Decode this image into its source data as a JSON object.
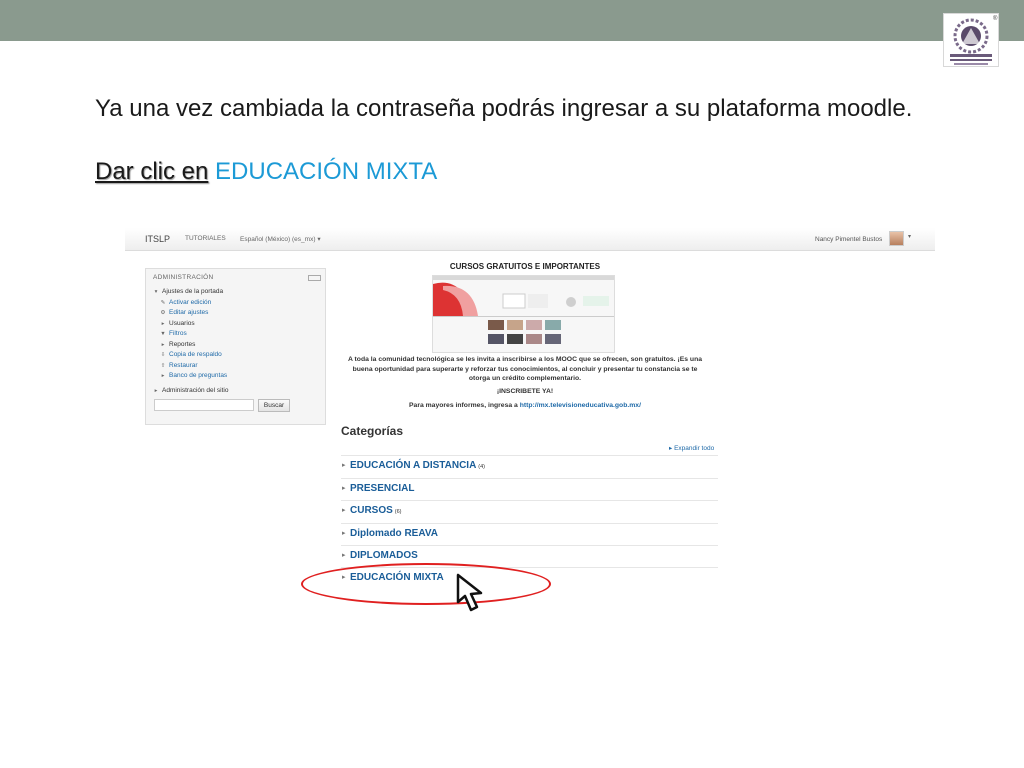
{
  "slide": {
    "instruction": "Ya una vez cambiada la contraseña podrás ingresar a su plataforma moodle.",
    "cta_prefix": "Dar clic en",
    "cta_highlight": "EDUCACIÓN MIXTA",
    "logo": "institution-seal-icon",
    "logo_mark": "®"
  },
  "moodle": {
    "nav": {
      "brand": "ITSLP",
      "tutoriales": "TUTORIALES",
      "language": "Español (México) (es_mx)",
      "language_caret": "▾",
      "user_name": "Nancy Pimentel Bustos",
      "user_caret": "▾"
    },
    "admin": {
      "title": "ADMINISTRACIÓN",
      "section": "Ajustes de la portada",
      "items": [
        {
          "label": "Activar edición",
          "icon": "pencil-icon",
          "glyph": "✎",
          "link": true
        },
        {
          "label": "Editar ajustes",
          "icon": "gear-icon",
          "glyph": "⚙",
          "link": true
        },
        {
          "label": "Usuarios",
          "icon": "chevron-right-icon",
          "glyph": "▸",
          "link": false
        },
        {
          "label": "Filtros",
          "icon": "filter-icon",
          "glyph": "▼",
          "link": true
        },
        {
          "label": "Reportes",
          "icon": "chevron-right-icon",
          "glyph": "▸",
          "link": false
        },
        {
          "label": "Copia de respaldo",
          "icon": "backup-icon",
          "glyph": "⇩",
          "link": true
        },
        {
          "label": "Restaurar",
          "icon": "restore-icon",
          "glyph": "⇧",
          "link": true
        },
        {
          "label": "Banco de preguntas",
          "icon": "chevron-right-icon",
          "glyph": "▸",
          "link": true
        }
      ],
      "site_admin": "Administración del sitio",
      "search_button": "Buscar"
    },
    "promo": {
      "title": "CURSOS GRATUITOS E IMPORTANTES",
      "body": "A toda la comunidad tecnológica se les invita a inscribirse a los MOOC que se ofrecen, son gratuitos. ¡Es una buena oportunidad para superarte y reforzar tus conocimientos, al concluir y presentar tu constancia se te otorga un crédito complementario.",
      "cta": "¡INSCRIBETE YA!",
      "info_prefix": "Para mayores informes, ingresa a",
      "info_link": "http://mx.televisioneducativa.gob.mx/"
    },
    "categories": {
      "title": "Categorías",
      "expand": "Expandir todo",
      "items": [
        {
          "label": "EDUCACIÓN A DISTANCIA",
          "count": "(4)"
        },
        {
          "label": "PRESENCIAL",
          "count": ""
        },
        {
          "label": "CURSOS",
          "count": "(6)"
        },
        {
          "label": "Diplomado REAVA",
          "count": ""
        },
        {
          "label": "DIPLOMADOS",
          "count": ""
        },
        {
          "label": "EDUCACIÓN MIXTA",
          "count": ""
        }
      ]
    }
  },
  "colors": {
    "topbar": "#8a9a8e",
    "highlight_text": "#1c9ad6",
    "category_link": "#1a5d98",
    "ellipse": "#e02020"
  }
}
